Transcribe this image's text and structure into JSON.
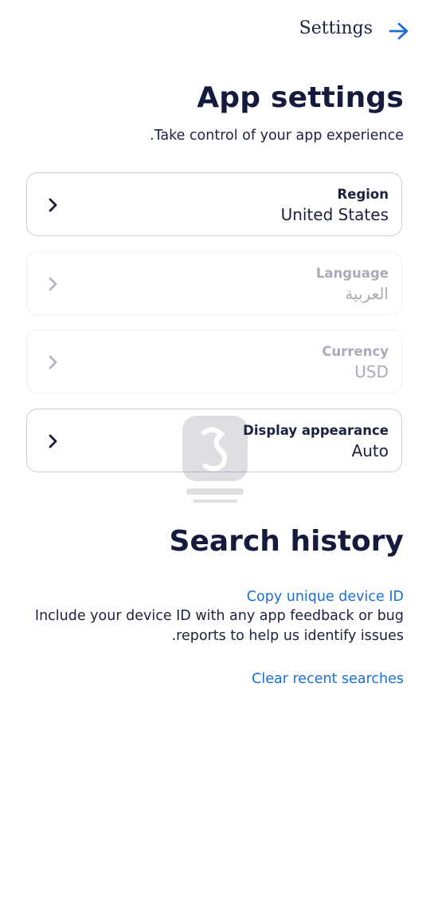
{
  "header": {
    "title": "Settings",
    "back_icon": "arrow-right-icon"
  },
  "page": {
    "title": "App settings",
    "subtitle": "Take control of your app experience."
  },
  "settings": [
    {
      "label": "Region",
      "value": "United States",
      "enabled": true
    },
    {
      "label": "Language",
      "value": "العربية",
      "enabled": false
    },
    {
      "label": "Currency",
      "value": "USD",
      "enabled": false
    },
    {
      "label": "Display appearance",
      "value": "Auto",
      "enabled": true
    }
  ],
  "search_history": {
    "title": "Search history",
    "copy_device_id_label": "Copy unique device ID",
    "device_id_help": "Include your device ID with any app feedback or bug reports to help us identify issues.",
    "clear_label": "Clear recent searches"
  },
  "colors": {
    "accent": "#1a6fd6",
    "text_primary": "#161b3d",
    "text_disabled": "#a9acb8",
    "card_border": "#c9ccd6"
  }
}
